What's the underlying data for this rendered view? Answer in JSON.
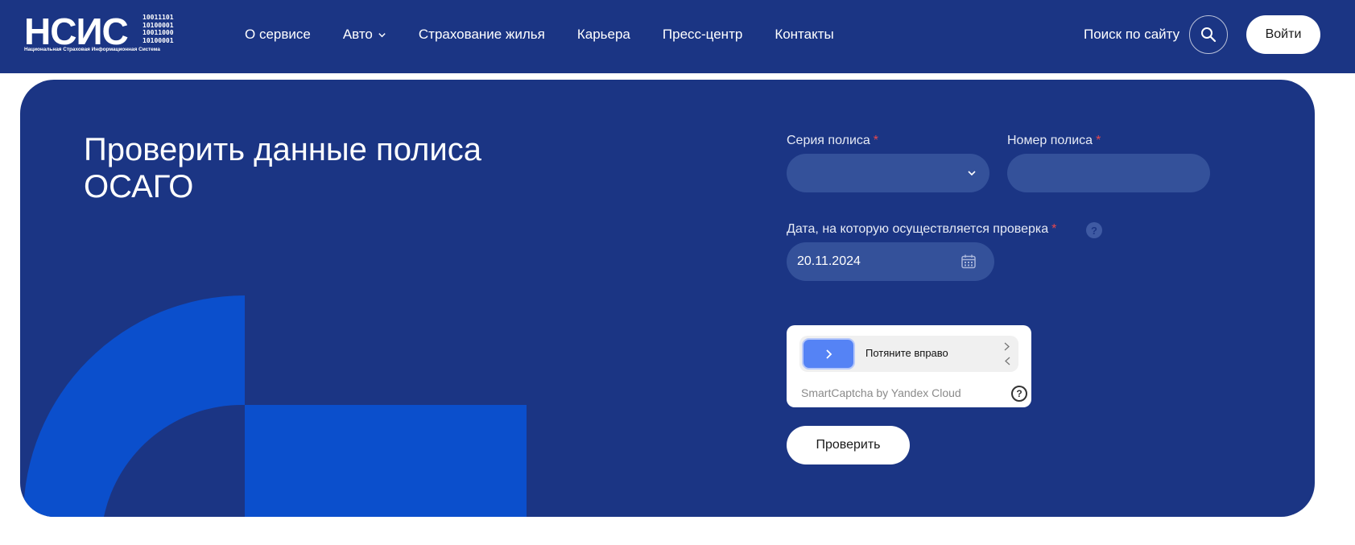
{
  "header": {
    "logo": {
      "main": "НСИС",
      "binary": [
        "10011101",
        "10100001",
        "10011000",
        "10100001"
      ],
      "subtitle": "Национальная Страховая Информационная Система"
    },
    "nav": [
      {
        "label": "О сервисе",
        "has_dropdown": false
      },
      {
        "label": "Авто",
        "has_dropdown": true
      },
      {
        "label": "Страхование жилья",
        "has_dropdown": false
      },
      {
        "label": "Карьера",
        "has_dropdown": false
      },
      {
        "label": "Пресс-центр",
        "has_dropdown": false
      },
      {
        "label": "Контакты",
        "has_dropdown": false
      }
    ],
    "search_label": "Поиск по сайту",
    "search_icon": "search-icon",
    "login_label": "Войти"
  },
  "hero": {
    "title_line1": "Проверить данные полиса",
    "title_line2": "ОСАГО"
  },
  "form": {
    "series": {
      "label": "Серия полиса",
      "required_mark": "*",
      "value": "",
      "icon": "chevron-down-icon"
    },
    "number": {
      "label": "Номер полиса",
      "required_mark": "*",
      "value": ""
    },
    "date": {
      "label": "Дата, на которую осуществляется проверка",
      "required_mark": "*",
      "help": "?",
      "value": "20.11.2024",
      "icon": "calendar-icon"
    },
    "captcha": {
      "slider_text": "Потяните вправо",
      "brand": "SmartCaptcha by Yandex Cloud",
      "help": "?"
    },
    "submit_label": "Проверить"
  },
  "colors": {
    "header_bg": "#1b3584",
    "card_bg": "#1b3584",
    "field_bg": "#34519a",
    "accent_blue": "#0b4fcc",
    "required": "#e5484d",
    "slider_handle": "#5583f5"
  }
}
